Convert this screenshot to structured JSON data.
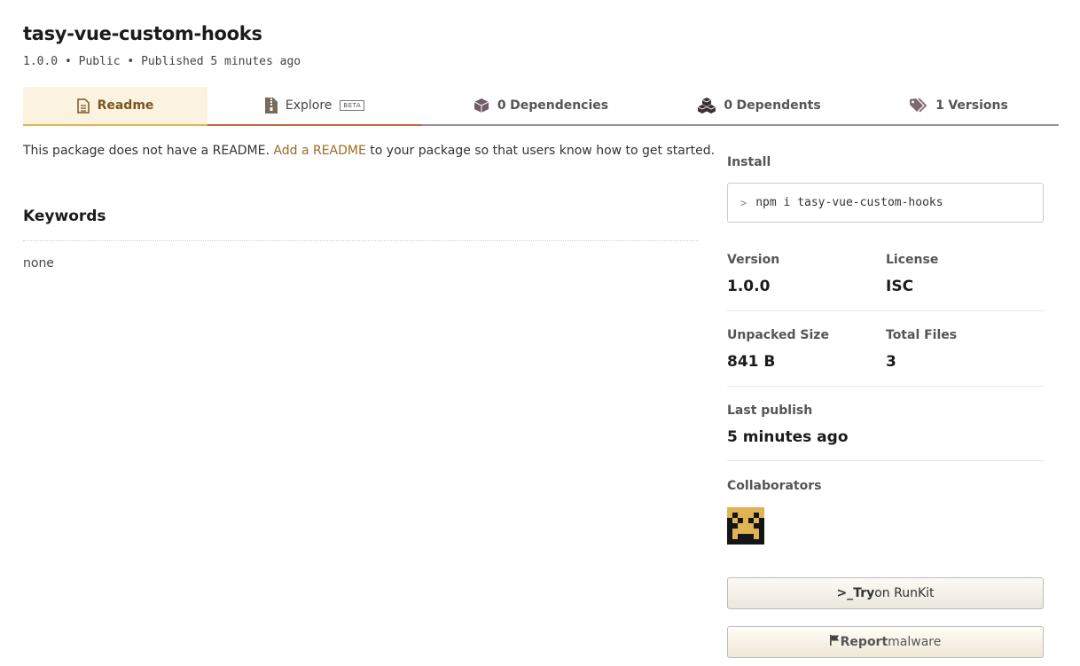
{
  "package": {
    "name": "tasy-vue-custom-hooks",
    "version": "1.0.0",
    "visibility": "Public",
    "published_prefix": "Published",
    "published_ago": "5 minutes ago",
    "separator": "•"
  },
  "tabs": [
    {
      "label": "Readme",
      "icon": "file-icon",
      "active": true
    },
    {
      "label": "Explore",
      "icon": "zip-file-icon",
      "badge": "BETA"
    },
    {
      "label": "Dependencies",
      "count": "0",
      "icon": "box-icon"
    },
    {
      "label": "Dependents",
      "count": "0",
      "icon": "boxes-icon"
    },
    {
      "label": "Versions",
      "count": "1",
      "icon": "tags-icon"
    }
  ],
  "readme": {
    "text_before": "This package does not have a README. ",
    "link_text": "Add a README",
    "text_after": " to your package so that users know how to get started."
  },
  "keywords": {
    "heading": "Keywords",
    "value": "none"
  },
  "sidebar": {
    "install_label": "Install",
    "install_prompt": ">",
    "install_command": "npm i tasy-vue-custom-hooks",
    "version_label": "Version",
    "version_value": "1.0.0",
    "license_label": "License",
    "license_value": "ISC",
    "unpacked_size_label": "Unpacked Size",
    "unpacked_size_value": "841 B",
    "total_files_label": "Total Files",
    "total_files_value": "3",
    "last_publish_label": "Last publish",
    "last_publish_value": "5 minutes ago",
    "collaborators_label": "Collaborators",
    "runkit_prefix": ">_",
    "runkit_bold": "Try",
    "runkit_rest": " on RunKit",
    "report_icon": "flag-icon",
    "report_bold": "Report",
    "report_rest": " malware"
  },
  "colors": {
    "active_tab_bg": "#fbf3df",
    "active_tab_border": "#e0b355",
    "explore_border": "#bf6a46",
    "inactive_border": "#9b8ea6",
    "link": "#9a6b26"
  }
}
